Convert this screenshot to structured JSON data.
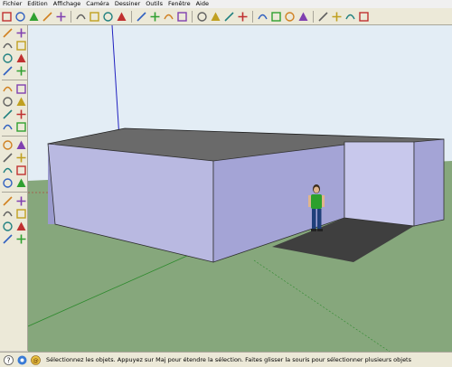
{
  "menu": [
    "Fichier",
    "Edition",
    "Affichage",
    "Caméra",
    "Dessiner",
    "Outils",
    "Fenêtre",
    "Aide"
  ],
  "toolbar": {
    "groups": [
      [
        "select-tool-icon",
        "eraser-tool-icon",
        "rectangle-tool-icon",
        "circle-tool-icon",
        "paint-bucket-icon"
      ],
      [
        "eraser-icon",
        "pushpull-icon",
        "arc-icon",
        "move-icon"
      ],
      [
        "rotate-icon",
        "offset-icon",
        "followme-icon",
        "tape-measure-icon"
      ],
      [
        "orbit-icon",
        "pan-icon",
        "zoom-icon",
        "zoom-extents-icon"
      ],
      [
        "get-models-icon",
        "share-model-icon",
        "components-icon",
        "photo-textures-icon"
      ],
      [
        "previous-view-icon",
        "section-icon",
        "walk-icon",
        "look-around-icon"
      ]
    ]
  },
  "left_toolbar": {
    "tools": [
      "select-icon",
      "make-component-icon",
      "paint-bucket-icon",
      "eraser-icon",
      "rectangle-icon",
      "line-icon",
      "circle-icon",
      "arc-icon",
      "polygon-icon",
      "freehand-icon",
      "move-icon",
      "pushpull-icon",
      "rotate-icon",
      "followme-icon",
      "scale-icon",
      "offset-icon",
      "tape-measure-icon",
      "dimension-icon",
      "protractor-icon",
      "text-icon",
      "axes-icon",
      "3d-text-icon",
      "orbit-icon",
      "pan-icon",
      "zoom-icon",
      "zoom-window-icon",
      "zoom-extents-icon",
      "previous-icon",
      "position-camera-icon",
      "walk-icon",
      "look-around-icon",
      "section-plane-icon"
    ]
  },
  "status": {
    "text": "Sélectionnez les objets. Appuyez sur Maj pour étendre la sélection. Faites glisser la souris pour sélectionner plusieurs objets"
  },
  "colors": {
    "sky": "#e3edf5",
    "ground": "#86a77c",
    "wall_front": "#b9b9e1",
    "wall_side": "#a4a4d6",
    "wall_inner": "#c8c8ec",
    "roof_edge": "#404040",
    "floor_shadow": "#3f3f3f",
    "person_shirt": "#2ca02c",
    "person_pants": "#1f3f7a"
  }
}
